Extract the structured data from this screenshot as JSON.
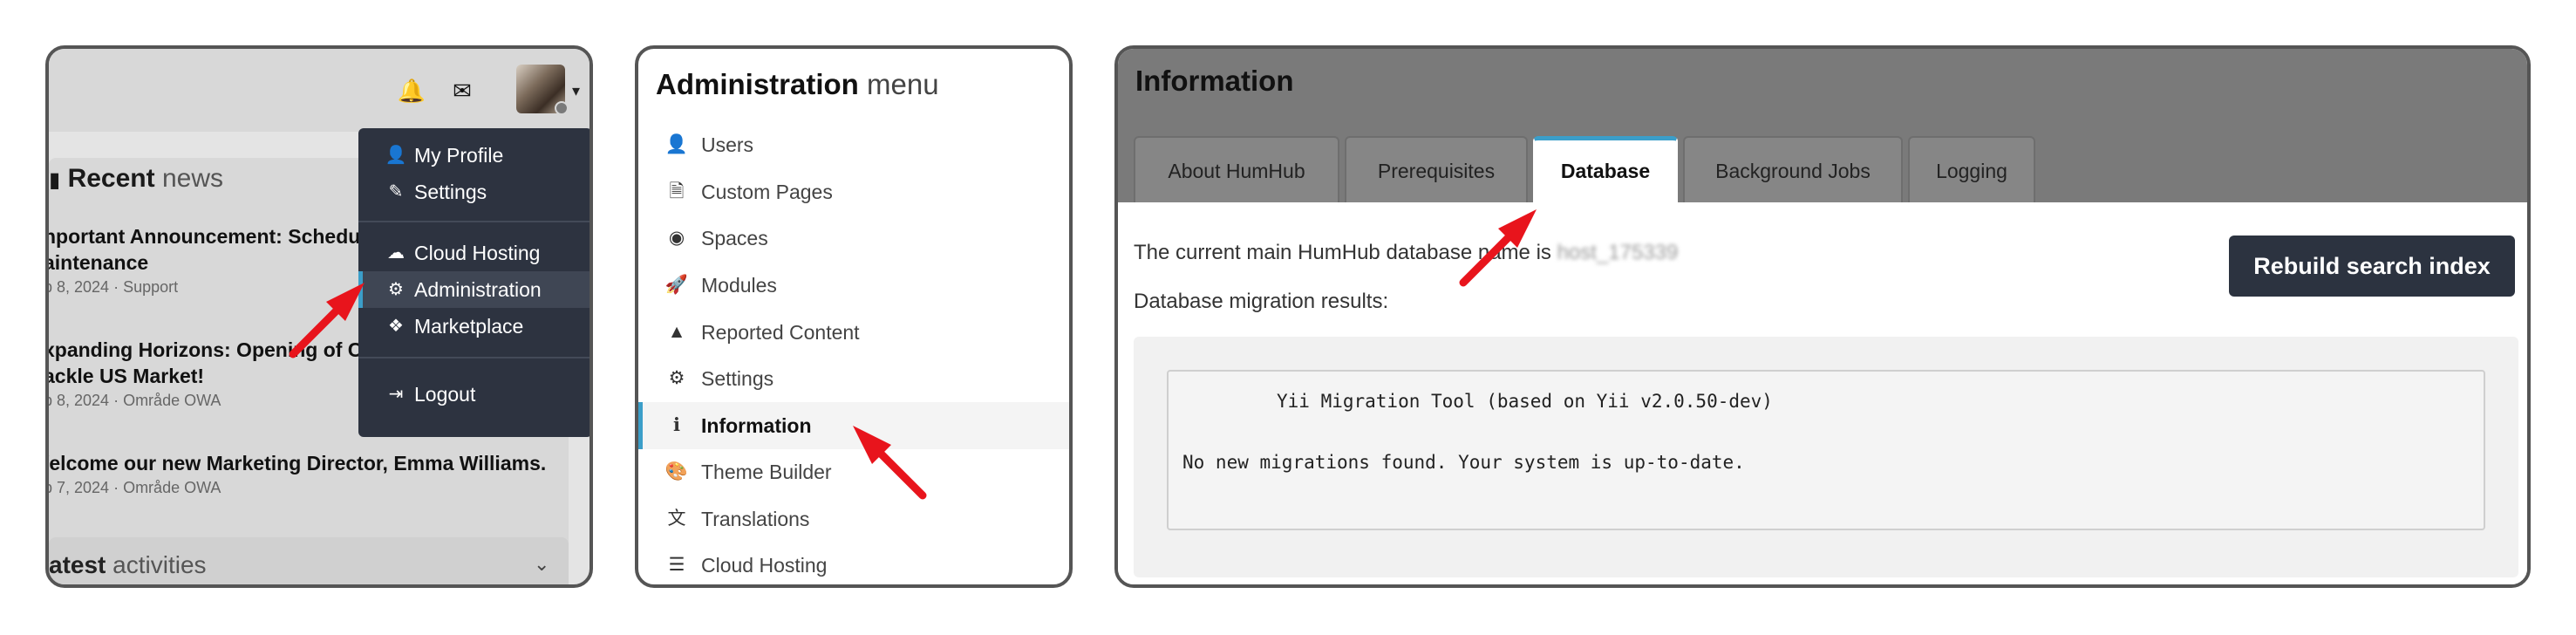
{
  "dashboard": {
    "topbar": {
      "bell_icon": "bell-icon",
      "mail_icon": "envelope-icon"
    },
    "user_menu": [
      {
        "label": "My Profile",
        "icon": "user-icon",
        "glyph": "👤"
      },
      {
        "label": "Settings",
        "icon": "pencil-icon",
        "glyph": "✎"
      },
      {
        "label": "Cloud Hosting",
        "icon": "cloud-icon",
        "glyph": "☁"
      },
      {
        "label": "Administration",
        "icon": "cogs-icon",
        "glyph": "⚙"
      },
      {
        "label": "Marketplace",
        "icon": "cubes-icon",
        "glyph": "❖"
      },
      {
        "label": "Logout",
        "icon": "sign-out-icon",
        "glyph": "⇥"
      }
    ],
    "news": {
      "title_bold": "Recent",
      "title_light": "news",
      "items": [
        {
          "headline_line1": "nportant Announcement: Schedu",
          "headline_line2": "aintenance",
          "meta": "b 8, 2024 · Support"
        },
        {
          "headline_line1": "xpanding Horizons: Opening of Ch",
          "headline_line2": "ackle US Market!",
          "meta": "b 8, 2024 · Område OWA"
        },
        {
          "headline_line1": "/elcome our new Marketing Director, Emma Williams.",
          "meta": "b 7, 2024 · Område OWA"
        }
      ]
    },
    "activities": {
      "title_bold": "atest",
      "title_light": "activities"
    }
  },
  "admin_menu": {
    "title_bold": "Administration",
    "title_light": "menu",
    "items": [
      {
        "label": "Users",
        "icon": "user-icon",
        "glyph": "👤"
      },
      {
        "label": "Custom Pages",
        "icon": "file-icon",
        "glyph": "🗎"
      },
      {
        "label": "Spaces",
        "icon": "dot-circle-icon",
        "glyph": "◉"
      },
      {
        "label": "Modules",
        "icon": "rocket-icon",
        "glyph": "🚀"
      },
      {
        "label": "Reported Content",
        "icon": "warning-icon",
        "glyph": "▲"
      },
      {
        "label": "Settings",
        "icon": "cogs-icon",
        "glyph": "⚙"
      },
      {
        "label": "Information",
        "icon": "info-circle-icon",
        "glyph": "ℹ"
      },
      {
        "label": "Theme Builder",
        "icon": "palette-icon",
        "glyph": "🎨"
      },
      {
        "label": "Translations",
        "icon": "language-icon",
        "glyph": "文"
      },
      {
        "label": "Cloud Hosting",
        "icon": "server-icon",
        "glyph": "☰"
      }
    ],
    "active": "Information"
  },
  "information": {
    "title": "Information",
    "tabs": [
      "About HumHub",
      "Prerequisites",
      "Database",
      "Background Jobs",
      "Logging"
    ],
    "active_tab": "Database",
    "db_name_text": "The current main HumHub database name is",
    "db_name_value": "host_175339",
    "migration_label": "Database migration results:",
    "rebuild_button": "Rebuild search index",
    "console_line1": "Yii Migration Tool (based on Yii v2.0.50-dev)",
    "console_line2": "No new migrations found. Your system is up-to-date."
  },
  "colors": {
    "accent": "#3b9ec9",
    "dark_nav": "#2d3340",
    "arrow": "#e8141c"
  }
}
